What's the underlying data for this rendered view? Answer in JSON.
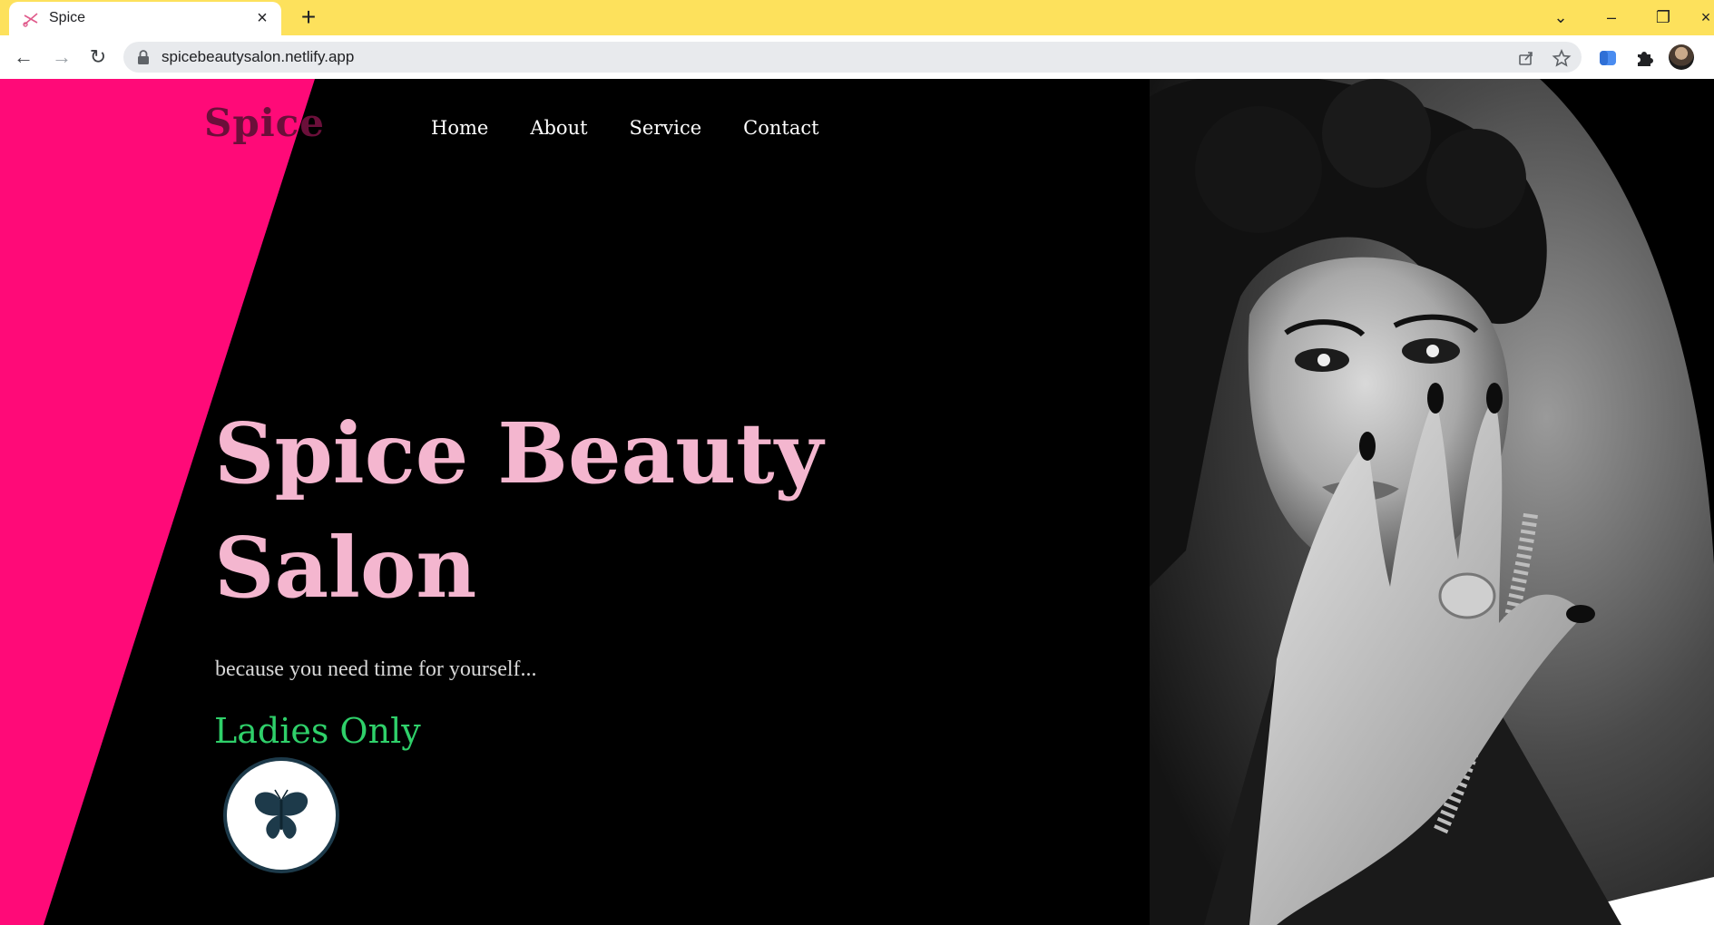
{
  "browser": {
    "tab_title": "Spice",
    "url": "spicebeautysalon.netlify.app"
  },
  "site": {
    "brand": "Spice",
    "nav": [
      "Home",
      "About",
      "Service",
      "Contact"
    ],
    "hero_title_line1": "Spice Beauty",
    "hero_title_line2": "Salon",
    "tagline": "because you need time for yourself...",
    "subtitle": "Ladies Only"
  },
  "colors": {
    "accent_pink": "#ff0a78",
    "hero_text": "#f4b6cf",
    "ladies_text": "#2fd06a",
    "tabstrip": "#fde15c"
  },
  "icons": {
    "badge": "butterfly-icon",
    "lock": "lock-icon"
  }
}
